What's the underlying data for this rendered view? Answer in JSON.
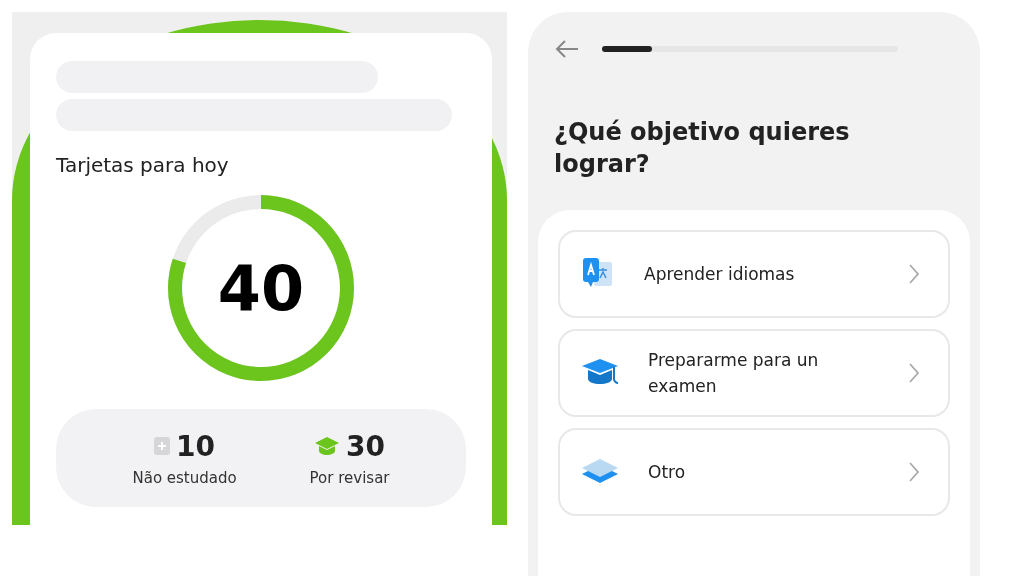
{
  "cards_today": {
    "title": "Tarjetas para hoy",
    "total": "40",
    "level": 0.8,
    "stats": [
      {
        "kind": "new",
        "value": "10",
        "label": "Não estudado"
      },
      {
        "kind": "review",
        "value": "30",
        "label": "Por revisar"
      }
    ]
  },
  "goal_screen": {
    "progress": {
      "level": 0.17
    },
    "title": "¿Qué objetivo quieres lograr?",
    "options": [
      {
        "kind": "languages",
        "label": "Aprender idiomas"
      },
      {
        "kind": "exam",
        "label": "Prepararme para un examen"
      },
      {
        "kind": "other",
        "label": "Otro"
      }
    ]
  }
}
